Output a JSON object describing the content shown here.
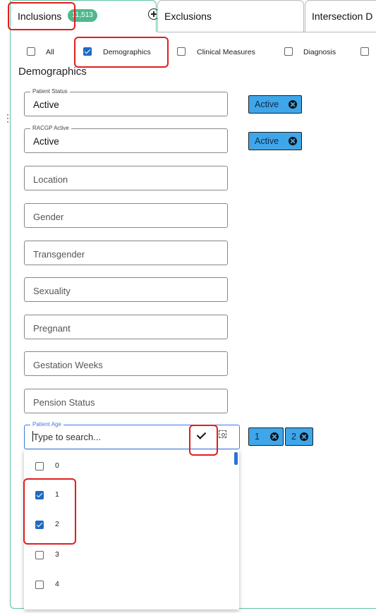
{
  "tabs": {
    "inclusions_label": "Inclusions",
    "inclusions_count": "11,513",
    "exclusions_label": "Exclusions",
    "intersection_label": "Intersection D"
  },
  "filters": [
    {
      "label": "All",
      "checked": false
    },
    {
      "label": "Demographics",
      "checked": true
    },
    {
      "label": "Clinical Measures",
      "checked": false
    },
    {
      "label": "Diagnosis",
      "checked": false
    }
  ],
  "section_title": "Demographics",
  "fields": {
    "patient_status": {
      "legend": "Patient Status",
      "value": "Active",
      "chip": "Active"
    },
    "racgp_active": {
      "legend": "RACGP Active",
      "value": "Active",
      "chip": "Active"
    },
    "location": {
      "placeholder": "Location"
    },
    "gender": {
      "placeholder": "Gender"
    },
    "transgender": {
      "placeholder": "Transgender"
    },
    "sexuality": {
      "placeholder": "Sexuality"
    },
    "pregnant": {
      "placeholder": "Pregnant"
    },
    "gestation_weeks": {
      "placeholder": "Gestation Weeks"
    },
    "pension_status": {
      "placeholder": "Pension Status"
    },
    "patient_age": {
      "legend": "Patient Age",
      "placeholder": "Type to search...",
      "chips": [
        "1",
        "2"
      ]
    }
  },
  "age_options": [
    {
      "label": "0",
      "checked": false
    },
    {
      "label": "1",
      "checked": true
    },
    {
      "label": "2",
      "checked": true
    },
    {
      "label": "3",
      "checked": false
    },
    {
      "label": "4",
      "checked": false
    }
  ],
  "colors": {
    "accent": "#5ec0a6",
    "chip": "#3fa6ea",
    "checkbox": "#1e6bc0",
    "annotation": "#e11d1d"
  }
}
